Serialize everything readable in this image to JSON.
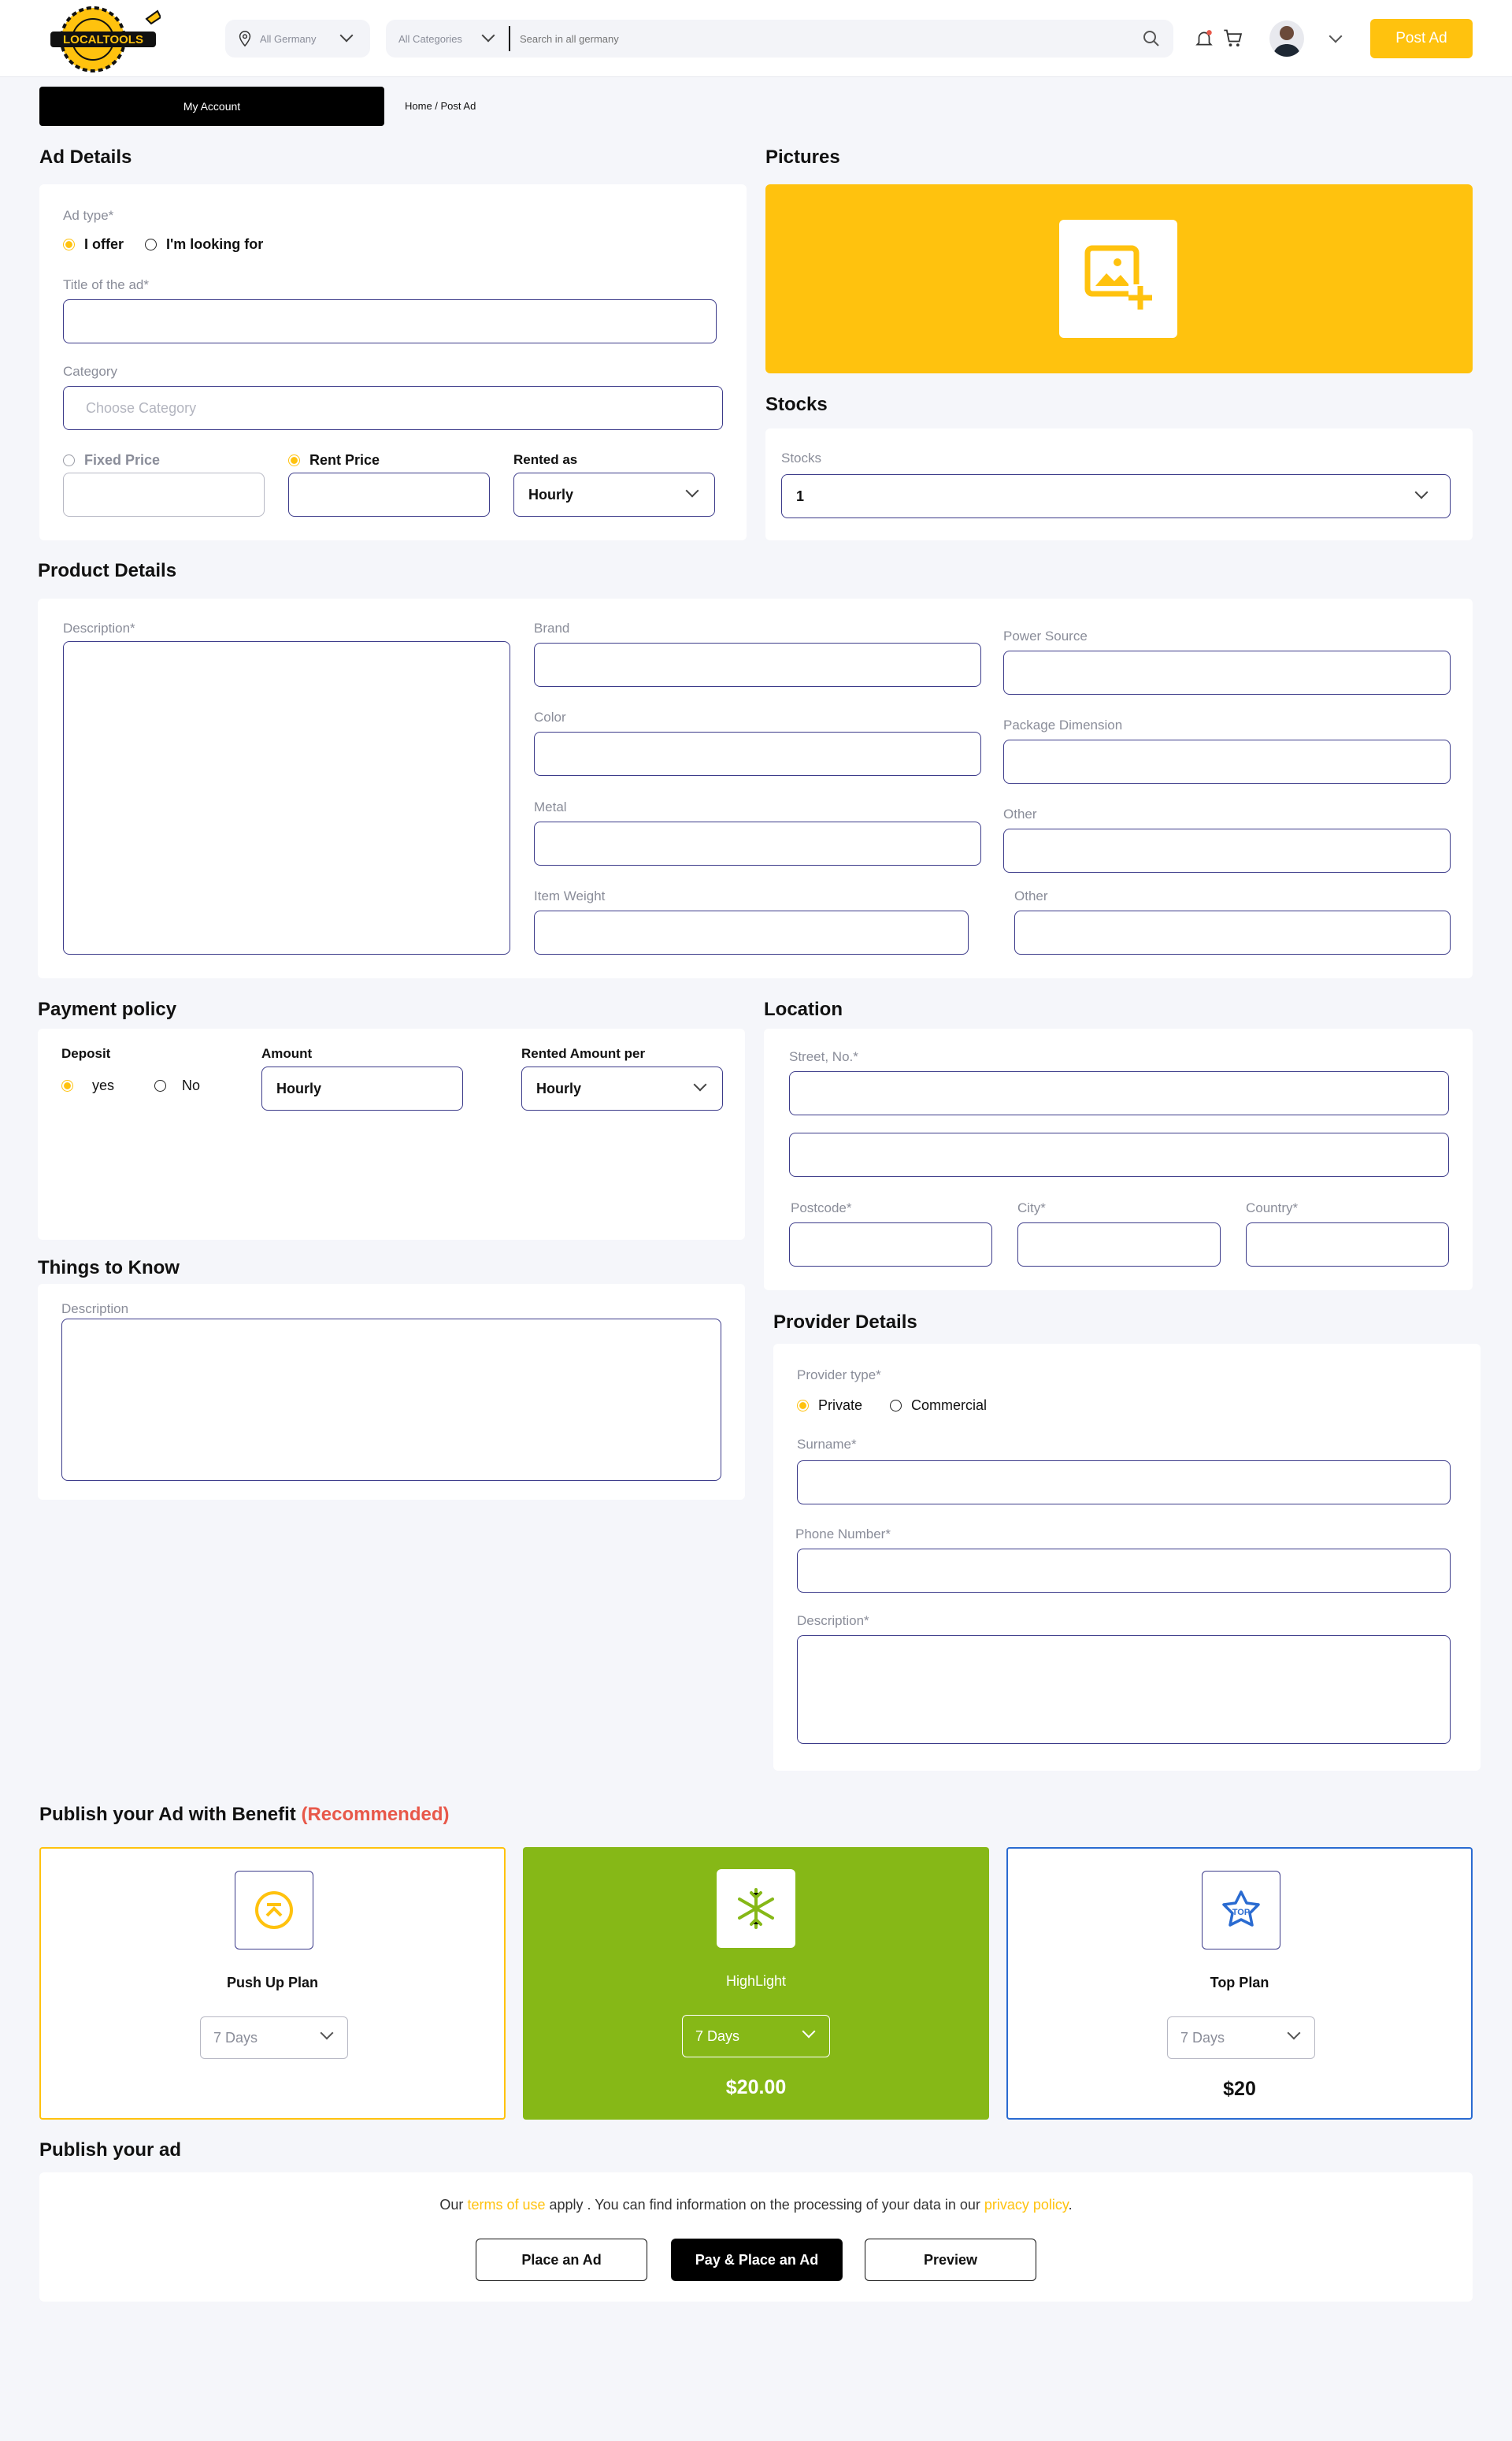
{
  "header": {
    "logo_text": "LOCALTOOLS",
    "location": "All Germany",
    "category": "All Categories",
    "search_placeholder": "Search in all germany",
    "post_ad_label": "Post Ad"
  },
  "subheader": {
    "account_label": "My Account",
    "breadcrumb": "Home /  Post Ad"
  },
  "ad_details": {
    "title": "Ad Details",
    "ad_type_label": "Ad type*",
    "option_offer": "I offer",
    "option_looking": "I'm looking for",
    "title_label": "Title of the ad*",
    "category_label": "Category",
    "category_placeholder": "Choose Category",
    "fixed_price_label": "Fixed Price",
    "rent_price_label": "Rent Price",
    "rented_as_label": "Rented as",
    "rented_as_value": "Hourly"
  },
  "pictures": {
    "title": "Pictures"
  },
  "stocks": {
    "title": "Stocks",
    "label": "Stocks",
    "value": "1"
  },
  "product_details": {
    "title": "Product Details",
    "description_label": "Description*",
    "brand_label": "Brand",
    "color_label": "Color",
    "metal_label": "Metal",
    "item_weight_label": "Item Weight",
    "power_source_label": "Power Source",
    "package_dimension_label": "Package Dimension",
    "other_label_1": "Other",
    "other_label_2": "Other"
  },
  "payment_policy": {
    "title": "Payment policy",
    "deposit_label": "Deposit",
    "yes_label": "yes",
    "no_label": "No",
    "amount_label": "Amount",
    "amount_value": "Hourly",
    "rented_amount_label": "Rented Amount per",
    "rented_amount_value": "Hourly"
  },
  "location": {
    "title": "Location",
    "street_label": "Street, No.*",
    "postcode_label": "Postcode*",
    "city_label": "City*",
    "country_label": "Country*"
  },
  "things_to_know": {
    "title": "Things to Know",
    "description_label": "Description"
  },
  "provider_details": {
    "title": "Provider Details",
    "provider_type_label": "Provider type*",
    "private_label": "Private",
    "commercial_label": "Commercial",
    "surname_label": "Surname*",
    "phone_label": "Phone Number*",
    "description_label": "Description*"
  },
  "publish_benefit": {
    "title": "Publish your Ad with Benefit",
    "recommended": "(Recommended)",
    "plans": [
      {
        "name": "Push Up Plan",
        "duration": "7 Days",
        "price": "",
        "accent": "#ffc20e"
      },
      {
        "name": "HighLight",
        "duration": "7 Days",
        "price": "$20.00",
        "accent": "#86b817"
      },
      {
        "name": "Top Plan",
        "duration": "7 Days",
        "price": "$20",
        "accent": "#2a6bd1"
      }
    ]
  },
  "publish": {
    "title": "Publish your ad",
    "terms_pre": "Our",
    "terms_link": "terms of use",
    "terms_mid": "apply . You can find information on the processing of your data in our",
    "privacy_link": "privacy policy",
    "terms_post": ".",
    "place_label": "Place an Ad",
    "pay_place_label": "Pay & Place an Ad",
    "preview_label": "Preview"
  },
  "colors": {
    "accent": "#ffc20e",
    "field_border": "#3c3b8a",
    "highlight_green": "#86b817",
    "top_blue": "#2a6bd1",
    "recommended_red": "#e8584a"
  }
}
